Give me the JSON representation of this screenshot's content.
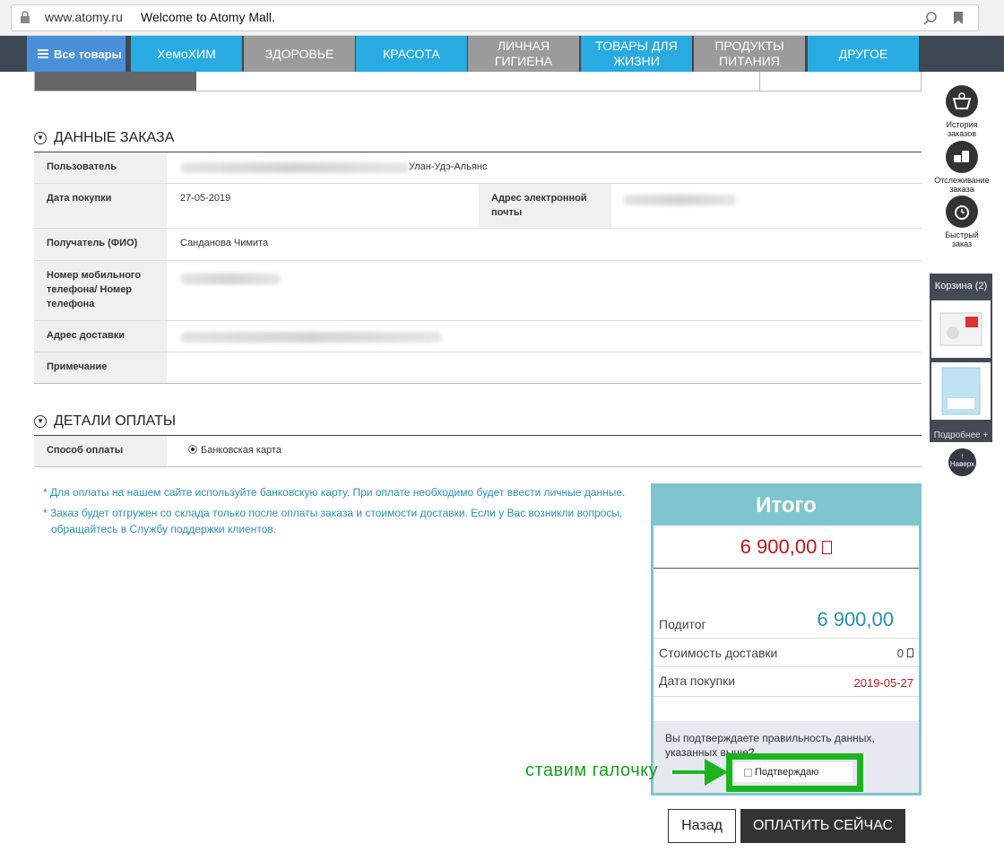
{
  "browser": {
    "url": "www.atomy.ru",
    "title": "Welcome to Atomy Mall."
  },
  "nav": {
    "all_label": "Все товары",
    "items": [
      {
        "label": "ХемоХИМ",
        "color": "#29abe2"
      },
      {
        "label": "ЗДОРОВЬЕ",
        "color": "#9b9b9b"
      },
      {
        "label": "КРАСОТА",
        "color": "#29abe2"
      },
      {
        "label": "ЛИЧНАЯ ГИГИЕНА",
        "color": "#9b9b9b"
      },
      {
        "label": "ТОВАРЫ ДЛЯ ЖИЗНИ",
        "color": "#29abe2"
      },
      {
        "label": "ПРОДУКТЫ ПИТАНИЯ",
        "color": "#9b9b9b"
      },
      {
        "label": "ДРУГОЕ",
        "color": "#29abe2"
      }
    ]
  },
  "order": {
    "title": "ДАННЫЕ ЗАКАЗА",
    "user_label": "Пользователь",
    "user_value": "Улан-Удэ-Альянс",
    "date_label": "Дата покупки",
    "date_value": "27-05-2019",
    "email_label": "Адрес электронной почты",
    "recipient_label": "Получатель (ФИО)",
    "recipient_value": "Санданова Чимита",
    "phone_label": "Номер мобильного телефона/ Номер телефона",
    "address_label": "Адрес доставки",
    "note_label": "Примечание"
  },
  "payment": {
    "title": "ДЕТАЛИ ОПЛАТЫ",
    "method_label": "Способ оплаты",
    "method_value": "Банковская карта",
    "notes": [
      "* Для оплаты на нашем сайте используйте банковскую карту. При оплате необходимо будет ввести личные данные.",
      "* Заказ будет отгружен со склада только после оплаты заказа и стоимости доставки. Если у Вас возникли вопросы, обращайтесь в Службу поддержки клиентов."
    ]
  },
  "summary": {
    "title": "Итого",
    "total": "6 900,00",
    "subtotal_label": "Подитог",
    "subtotal_value": "6 900,00",
    "shipping_label": "Стоимость доставки",
    "shipping_value": "0",
    "date_label": "Дата покупки",
    "date_value": "2019-05-27",
    "confirm_question": "Вы подтверждаете правильность данных, указанных выше?",
    "confirm_label": "Подтверждаю",
    "accent_color": "#7ec5cf",
    "total_color": "#c0141b"
  },
  "annotation": {
    "text": "ставим галочку",
    "color": "#1db31d"
  },
  "buttons": {
    "back": "Назад",
    "pay": "ОПЛАТИТЬ СЕЙЧАС"
  },
  "sidebar": {
    "history": "История заказов",
    "tracking": "Отслеживание заказа",
    "quick": "Быстрый заказ",
    "cart": "Корзина (2)",
    "more": "Подробнее +",
    "top": "Наверх"
  }
}
